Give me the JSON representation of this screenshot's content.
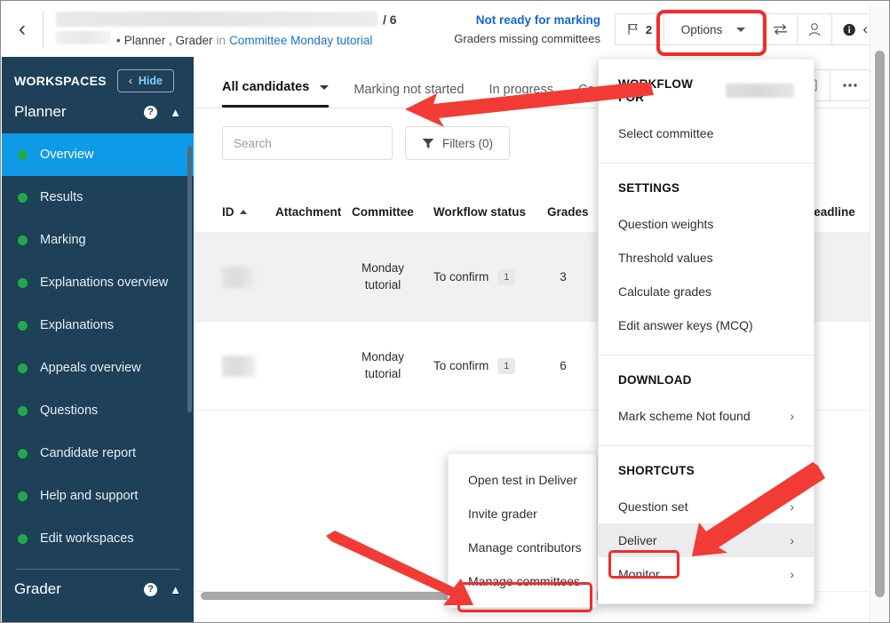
{
  "header": {
    "back_icon": "chevron-left-icon",
    "title_redacted": "",
    "count_label": "/ 6",
    "subject_redacted": "",
    "bullet": "•",
    "roles": "Planner , Grader",
    "in_word": "in",
    "committee_link": "Committee Monday tutorial",
    "status_main": "Not ready for marking",
    "status_sub": "Graders missing committees",
    "flag_count": "2",
    "options_label": "Options",
    "transfer_icon": "transfer-icon",
    "user_icon": "user-icon",
    "info_icon": "info-icon",
    "collapse_icon": "chevron-left-icon"
  },
  "sidebar": {
    "heading": "WORKSPACES",
    "hide_label": "Hide",
    "groups": [
      {
        "name": "Planner",
        "items": [
          {
            "label": "Overview",
            "active": true
          },
          {
            "label": "Results",
            "active": false
          },
          {
            "label": "Marking",
            "active": false
          },
          {
            "label": "Explanations overview",
            "active": false
          },
          {
            "label": "Explanations",
            "active": false
          },
          {
            "label": "Appeals overview",
            "active": false
          },
          {
            "label": "Questions",
            "active": false
          },
          {
            "label": "Candidate report",
            "active": false
          },
          {
            "label": "Help and support",
            "active": false
          },
          {
            "label": "Edit workspaces",
            "active": false
          }
        ]
      },
      {
        "name": "Grader",
        "items": []
      }
    ],
    "colors": {
      "background": "#1e4058",
      "active": "#0f9ae8",
      "bullet": "#21a84a"
    }
  },
  "main": {
    "tabs": [
      {
        "label": "All candidates",
        "active": true,
        "has_caret": true
      },
      {
        "label": "Marking not started",
        "active": false,
        "has_caret": false
      },
      {
        "label": "In progress",
        "active": false,
        "has_caret": false
      },
      {
        "label": "Co",
        "active": false,
        "has_caret": false
      }
    ],
    "search_placeholder": "Search",
    "search_value": "",
    "search_icon": "search-icon",
    "filters_label": "Filters (0)",
    "filter_icon": "funnel-icon",
    "copy_icon": "copy-icon",
    "more_icon": "ellipsis-icon",
    "table": {
      "columns": [
        "ID",
        "Attachment",
        "Committee",
        "Workflow status",
        "Grades",
        "g deadline"
      ],
      "sort_column": "ID",
      "sort_dir": "asc",
      "rows": [
        {
          "id_redacted": "",
          "attachment": "",
          "committee_line1": "Monday",
          "committee_line2": "tutorial",
          "workflow_status": "To confirm",
          "workflow_badge": "1",
          "grades": "3",
          "deadline": ""
        },
        {
          "id_redacted": "",
          "attachment": "",
          "committee_line1": "Monday",
          "committee_line2": "tutorial",
          "workflow_status": "To confirm",
          "workflow_badge": "1",
          "grades": "6",
          "deadline": ""
        }
      ]
    }
  },
  "options_panel": {
    "section1_title": "WORKFLOW FOR",
    "section1_items": [
      {
        "label": "Select committee",
        "chevron": false,
        "hovered": false
      }
    ],
    "section2_title": "SETTINGS",
    "section2_items": [
      {
        "label": "Question weights",
        "chevron": false,
        "hovered": false
      },
      {
        "label": "Threshold values",
        "chevron": false,
        "hovered": false
      },
      {
        "label": "Calculate grades",
        "chevron": false,
        "hovered": false
      },
      {
        "label": "Edit answer keys (MCQ)",
        "chevron": false,
        "hovered": false
      }
    ],
    "section3_title": "DOWNLOAD",
    "section3_items": [
      {
        "label": "Mark scheme Not found",
        "chevron": true,
        "hovered": false
      }
    ],
    "section4_title": "SHORTCUTS",
    "section4_items": [
      {
        "label": "Question set",
        "chevron": true,
        "hovered": false
      },
      {
        "label": "Deliver",
        "chevron": true,
        "hovered": true
      },
      {
        "label": "Monitor",
        "chevron": true,
        "hovered": false
      }
    ]
  },
  "context_menu": {
    "items": [
      {
        "label": "Open test in Deliver"
      },
      {
        "label": "Invite grader"
      },
      {
        "label": "Manage contributors"
      },
      {
        "label": "Manage committees"
      }
    ]
  },
  "annotations": {
    "highlight_color": "#f02d2d",
    "highlighted": [
      "Options",
      "Deliver",
      "Manage committees"
    ],
    "arrow_count": 3
  }
}
